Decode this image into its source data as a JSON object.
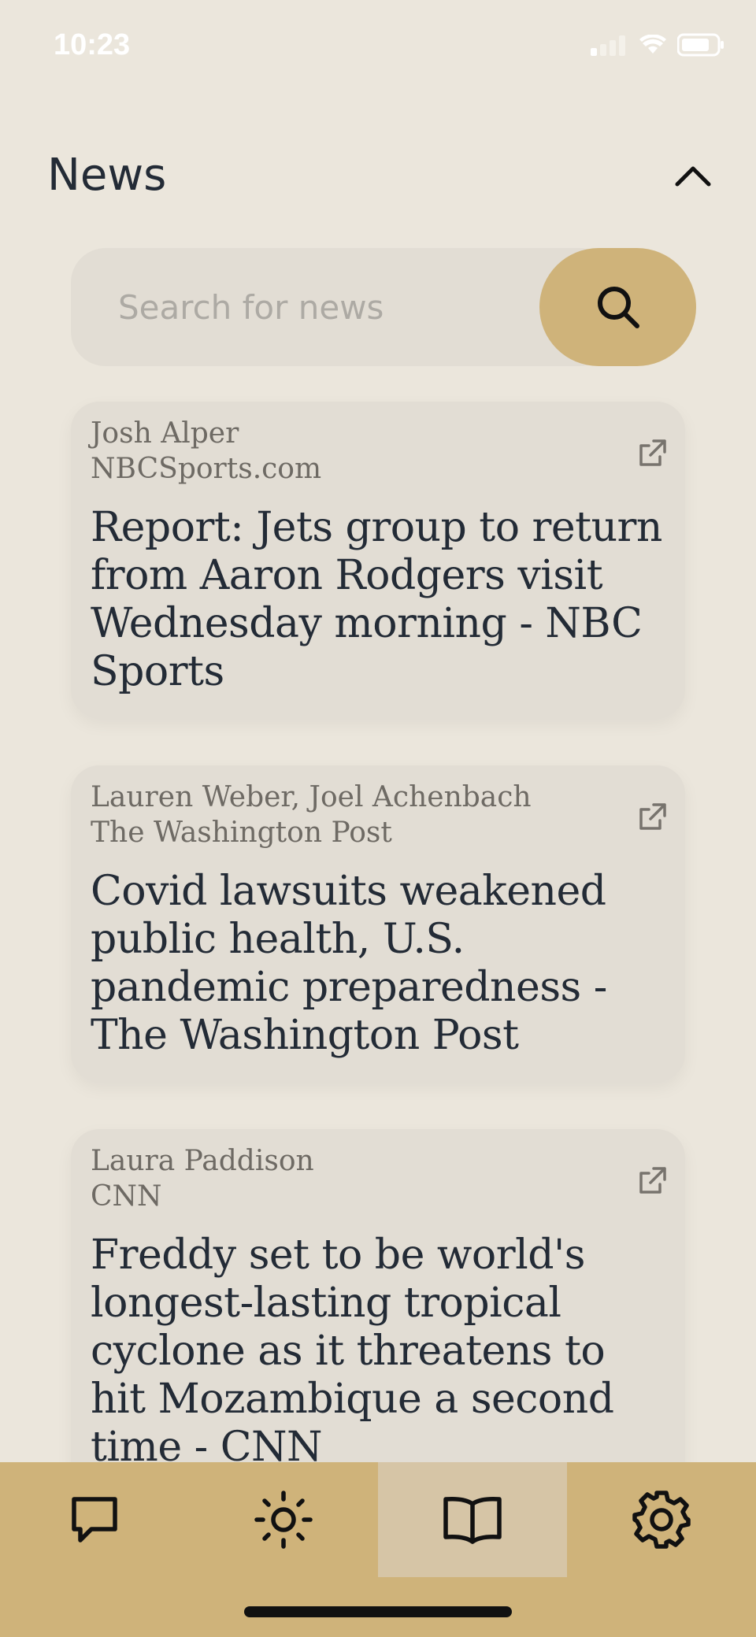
{
  "status_bar": {
    "time": "10:23"
  },
  "header": {
    "title": "News"
  },
  "search": {
    "placeholder": "Search for news"
  },
  "articles": [
    {
      "author": "Josh Alper",
      "source": "NBCSports.com",
      "title": "Report: Jets group to return from Aaron Rodgers visit Wednesday morning - NBC Sports"
    },
    {
      "author": "Lauren Weber, Joel Achenbach",
      "source": "The Washington Post",
      "title": "Covid lawsuits weakened public health, U.S. pandemic preparedness - The Washington Post"
    },
    {
      "author": "Laura Paddison",
      "source": "CNN",
      "title": "Freddy set to be world's longest-lasting tropical cyclone as it threatens to hit Mozambique a second time - CNN"
    }
  ],
  "tab_bar": {
    "items": [
      {
        "icon": "chat-icon",
        "active": false
      },
      {
        "icon": "sun-icon",
        "active": false
      },
      {
        "icon": "book-icon",
        "active": true
      },
      {
        "icon": "gear-icon",
        "active": false
      }
    ]
  },
  "colors": {
    "background": "#ebe6dc",
    "card": "#e2ddd4",
    "accent": "#cfb37a",
    "active_tab": "#d6c5a6",
    "text_primary": "#232b36",
    "text_secondary": "#6e6a64"
  }
}
